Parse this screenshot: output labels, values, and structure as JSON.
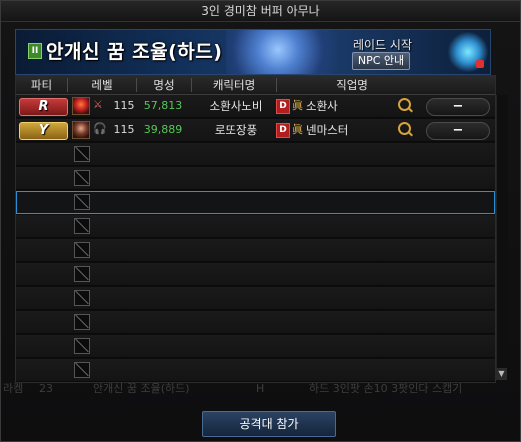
{
  "window": {
    "title": "3인 경미참 버퍼 아무나"
  },
  "banner": {
    "dungeon_name": "안개신 꿈 조율(하드)",
    "raid_start_label": "레이드 시작",
    "npc_button_label": "NPC 안내",
    "chip_label": "II"
  },
  "table": {
    "headers": {
      "party": "파티",
      "level": "레벨",
      "fame": "명성",
      "character_name": "캐릭터명",
      "job": "직업명"
    },
    "members": [
      {
        "party_label": "R",
        "party_color": "#c73a3a",
        "level": "115",
        "fame": "57,813",
        "character_name": "소환사노비",
        "job_badge": "D",
        "job_mark": "眞",
        "job": "소환사",
        "status_icon": "sword-icon",
        "remove_label": "−"
      },
      {
        "party_label": "Y",
        "party_color": "#d2a63a",
        "level": "115",
        "fame": "39,889",
        "character_name": "로또장풍",
        "job_badge": "D",
        "job_mark": "眞",
        "job": "넨마스터",
        "status_icon": "headset-icon",
        "remove_label": "−"
      }
    ],
    "empty_slots": 10,
    "selected_empty_slot": 3
  },
  "background_row": {
    "col1": "라켐",
    "col2": "23",
    "col3": "안개신 꿈 조율(하드)",
    "col4": "H",
    "col5": "하드 3인팟 손10 3팟인다 스캡기"
  },
  "footer": {
    "join_button_label": "공격대 참가"
  },
  "colors": {
    "accent": "#2c8fd6",
    "fame_green": "#55c955",
    "badge_red": "#b21e1e",
    "magnifier_gold": "#d7a43a"
  }
}
